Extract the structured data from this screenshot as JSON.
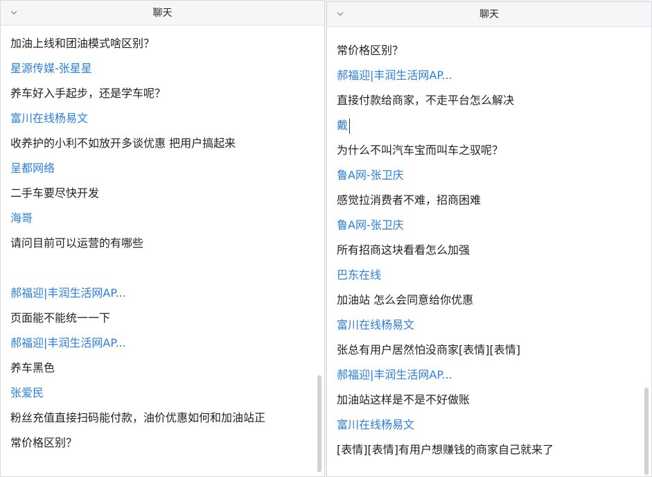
{
  "left_panel": {
    "title": "聊天",
    "items": [
      {
        "type": "msg",
        "text": "加油上线和团油模式啥区别？"
      },
      {
        "type": "sender",
        "text": "星源传媒-张星星"
      },
      {
        "type": "msg",
        "text": "养车好入手起步，还是学车呢？"
      },
      {
        "type": "sender",
        "text": "富川在线杨易文"
      },
      {
        "type": "msg",
        "text": "收养护的小利不如放开多谈优惠 把用户搞起来"
      },
      {
        "type": "sender",
        "text": "呈都网络"
      },
      {
        "type": "msg",
        "text": "二手车要尽快开发"
      },
      {
        "type": "sender",
        "text": "海哥"
      },
      {
        "type": "msg",
        "text": "请问目前可以运营的有哪些"
      },
      {
        "type": "blank",
        "text": ""
      },
      {
        "type": "sender",
        "text": "郝福迎|丰润生活网AP..."
      },
      {
        "type": "msg",
        "text": "页面能不能统一一下"
      },
      {
        "type": "sender",
        "text": "郝福迎|丰润生活网AP..."
      },
      {
        "type": "msg",
        "text": "养车黑色"
      },
      {
        "type": "sender",
        "text": "张爱民"
      },
      {
        "type": "msg",
        "text": "粉丝充值直接扫码能付款，油价优惠如何和加油站正"
      },
      {
        "type": "msg",
        "text": "常价格区别？"
      }
    ]
  },
  "right_panel": {
    "title": "聊天",
    "items": [
      {
        "type": "msg",
        "text": "常价格区别？"
      },
      {
        "type": "sender",
        "text": "郝福迎|丰润生活网AP..."
      },
      {
        "type": "msg",
        "text": "直接付款给商家，不走平台怎么解决"
      },
      {
        "type": "sender",
        "text": "戴",
        "caret": true
      },
      {
        "type": "msg",
        "text": "为什么不叫汽车宝而叫车之驭呢？"
      },
      {
        "type": "sender",
        "text": "鲁A网-张卫庆"
      },
      {
        "type": "msg",
        "text": "感觉拉消费者不难，招商困难"
      },
      {
        "type": "sender",
        "text": "鲁A网-张卫庆"
      },
      {
        "type": "msg",
        "text": "所有招商这块看看怎么加强"
      },
      {
        "type": "sender",
        "text": "巴东在线"
      },
      {
        "type": "msg",
        "text": "加油站 怎么会同意给你优惠"
      },
      {
        "type": "sender",
        "text": "富川在线杨易文"
      },
      {
        "type": "msg",
        "text": "张总有用户居然怕没商家[表情][表情]"
      },
      {
        "type": "sender",
        "text": "郝福迎|丰润生活网AP..."
      },
      {
        "type": "msg",
        "text": "加油站这样是不是不好做账"
      },
      {
        "type": "sender",
        "text": "富川在线杨易文"
      },
      {
        "type": "msg",
        "text": "[表情][表情]有用户想赚钱的商家自己就来了"
      }
    ]
  },
  "icons": {
    "collapse": "chevron-down-icon"
  },
  "colors": {
    "sender": "#2a7de1",
    "message": "#222222",
    "header_bg": "#f5f6f7"
  }
}
